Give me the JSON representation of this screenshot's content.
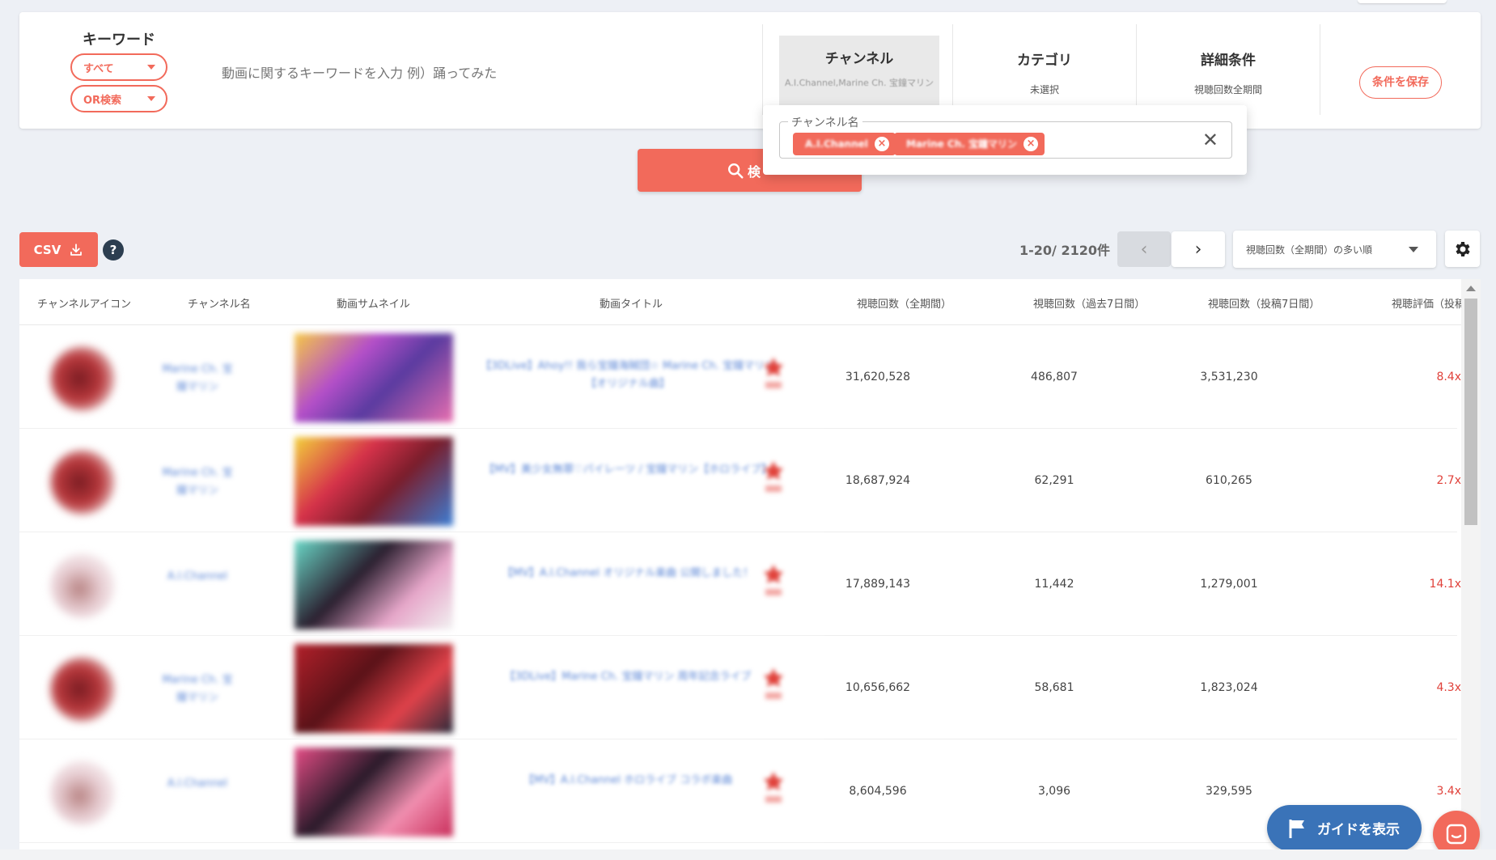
{
  "filter": {
    "keyword_title": "キーワード",
    "scope_select": "すべて",
    "mode_select": "OR検索",
    "keyword_placeholder": "動画に関するキーワードを入力 例）踊ってみた",
    "channel": {
      "title": "チャンネル",
      "value": "A.I.Channel,Marine Ch. 宝鐘マリン"
    },
    "category": {
      "title": "カテゴリ",
      "value": "未選択"
    },
    "detail": {
      "title": "詳細条件",
      "value": "視聴回数全期間"
    },
    "save_label": "条件を保存"
  },
  "channel_popup": {
    "legend": "チャンネル名",
    "chips": [
      "A.I.Channel",
      "Marine Ch. 宝鐘マリン"
    ]
  },
  "search_label": "検",
  "toolbar": {
    "csv_label": "CSV",
    "help_label": "?",
    "count": "1-20/ 2120件",
    "sort_value": "視聴回数（全期間）の多い順"
  },
  "table": {
    "headers": [
      "チャンネルアイコン",
      "チャンネル名",
      "動画サムネイル",
      "動画タイトル",
      "視聴回数（全期間）",
      "視聴回数（過去7日間）",
      "視聴回数（投稿7日間）",
      "視聴評価（投稿"
    ],
    "rows": [
      {
        "channel": "Marine Ch. 宝鐘マリン",
        "title": "【3DLive】Ahoy!! 我ら宝鐘海賊団☆ Marine Ch. 宝鐘マリン【オリジナル曲】",
        "views_all": "31,620,528",
        "views_7d": "486,807",
        "views_post7d": "3,531,230",
        "rating": "8.4x",
        "av": "red"
      },
      {
        "channel": "Marine Ch. 宝鐘マリン",
        "title": "【MV】美少女無罪♡パイレーツ / 宝鐘マリン【ホロライブ】",
        "views_all": "18,687,924",
        "views_7d": "62,291",
        "views_post7d": "610,265",
        "rating": "2.7x",
        "av": "red"
      },
      {
        "channel": "A.I.Channel",
        "title": "【MV】A.I.Channel オリジナル楽曲 公開しました！",
        "views_all": "17,889,143",
        "views_7d": "11,442",
        "views_post7d": "1,279,001",
        "rating": "14.1x",
        "av": "light"
      },
      {
        "channel": "Marine Ch. 宝鐘マリン",
        "title": "【3DLive】Marine Ch. 宝鐘マリン 周年記念ライブ",
        "views_all": "10,656,662",
        "views_7d": "58,681",
        "views_post7d": "1,823,024",
        "rating": "4.3x",
        "av": "red"
      },
      {
        "channel": "A.I.Channel",
        "title": "【MV】A.I.Channel ホロライブ コラボ楽曲",
        "views_all": "8,604,596",
        "views_7d": "3,096",
        "views_post7d": "329,595",
        "rating": "3.4x",
        "av": "light"
      }
    ]
  },
  "guide_label": "ガイドを表示",
  "colors": {
    "accent": "#f26a5b",
    "link": "#5b86d6",
    "guide": "#3a73b8",
    "rating": "#e0413a"
  }
}
